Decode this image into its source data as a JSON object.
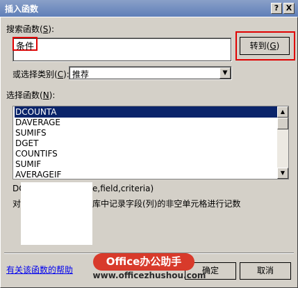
{
  "dialog": {
    "title": "插入函数",
    "help_button": "?",
    "close_button": "X"
  },
  "search": {
    "label_prefix": "搜索函数(",
    "label_mnemonic": "S",
    "label_suffix": "):",
    "value": "条件",
    "go_button_prefix": "转到(",
    "go_button_mnemonic": "G",
    "go_button_suffix": ")"
  },
  "category": {
    "label_prefix": "或选择类别(",
    "label_mnemonic": "C",
    "label_suffix": "):",
    "value": "推荐"
  },
  "function_list": {
    "label_prefix": "选择函数(",
    "label_mnemonic": "N",
    "label_suffix": "):",
    "items": [
      "DCOUNTA",
      "DAVERAGE",
      "SUMIFS",
      "DGET",
      "COUNTIFS",
      "SUMIF",
      "AVERAGEIF"
    ],
    "selected_index": 0
  },
  "description": {
    "syntax_left": "DC",
    "syntax_right": "e,field,criteria)",
    "text_left": "对",
    "text_right": "库中记录字段(列)的非空单元格进行记数"
  },
  "footer": {
    "help_link": "有关该函数的帮助",
    "ok_button": "确定",
    "cancel_button": "取消"
  },
  "watermark": {
    "badge_text": "Office办公助手",
    "url": "www.officezhushou.com"
  },
  "colors": {
    "title_bar": "#5f7fb8",
    "selection": "#0a246a",
    "highlight_red": "#e00000",
    "watermark_red": "#d83a2b"
  }
}
